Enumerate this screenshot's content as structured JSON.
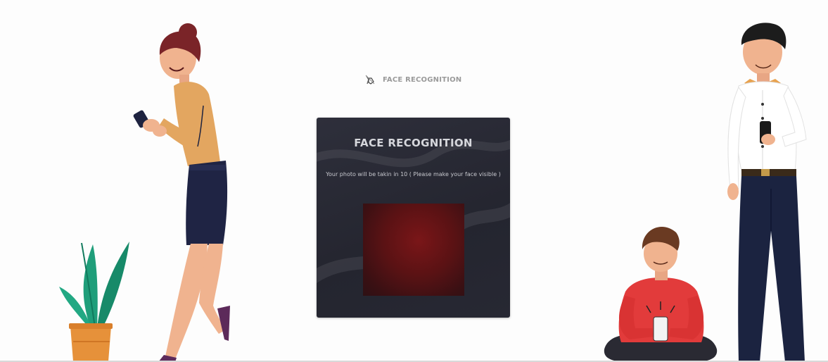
{
  "header": {
    "icon": "face-scan-icon",
    "title": "FACE RECOGNITION"
  },
  "card": {
    "title": "FACE RECOGNITION",
    "countdown_message": "Your photo will be takin in 10 ( Please make your face visible )"
  },
  "camera": {
    "state": "camera-preview"
  },
  "colors": {
    "card_background": "#2a2b36",
    "preview_red": "#6b1416",
    "header_text": "#9a9a9a"
  },
  "illustrations": [
    "woman-with-phone",
    "potted-plant",
    "sitting-boy-with-phone",
    "standing-man-with-phone"
  ]
}
